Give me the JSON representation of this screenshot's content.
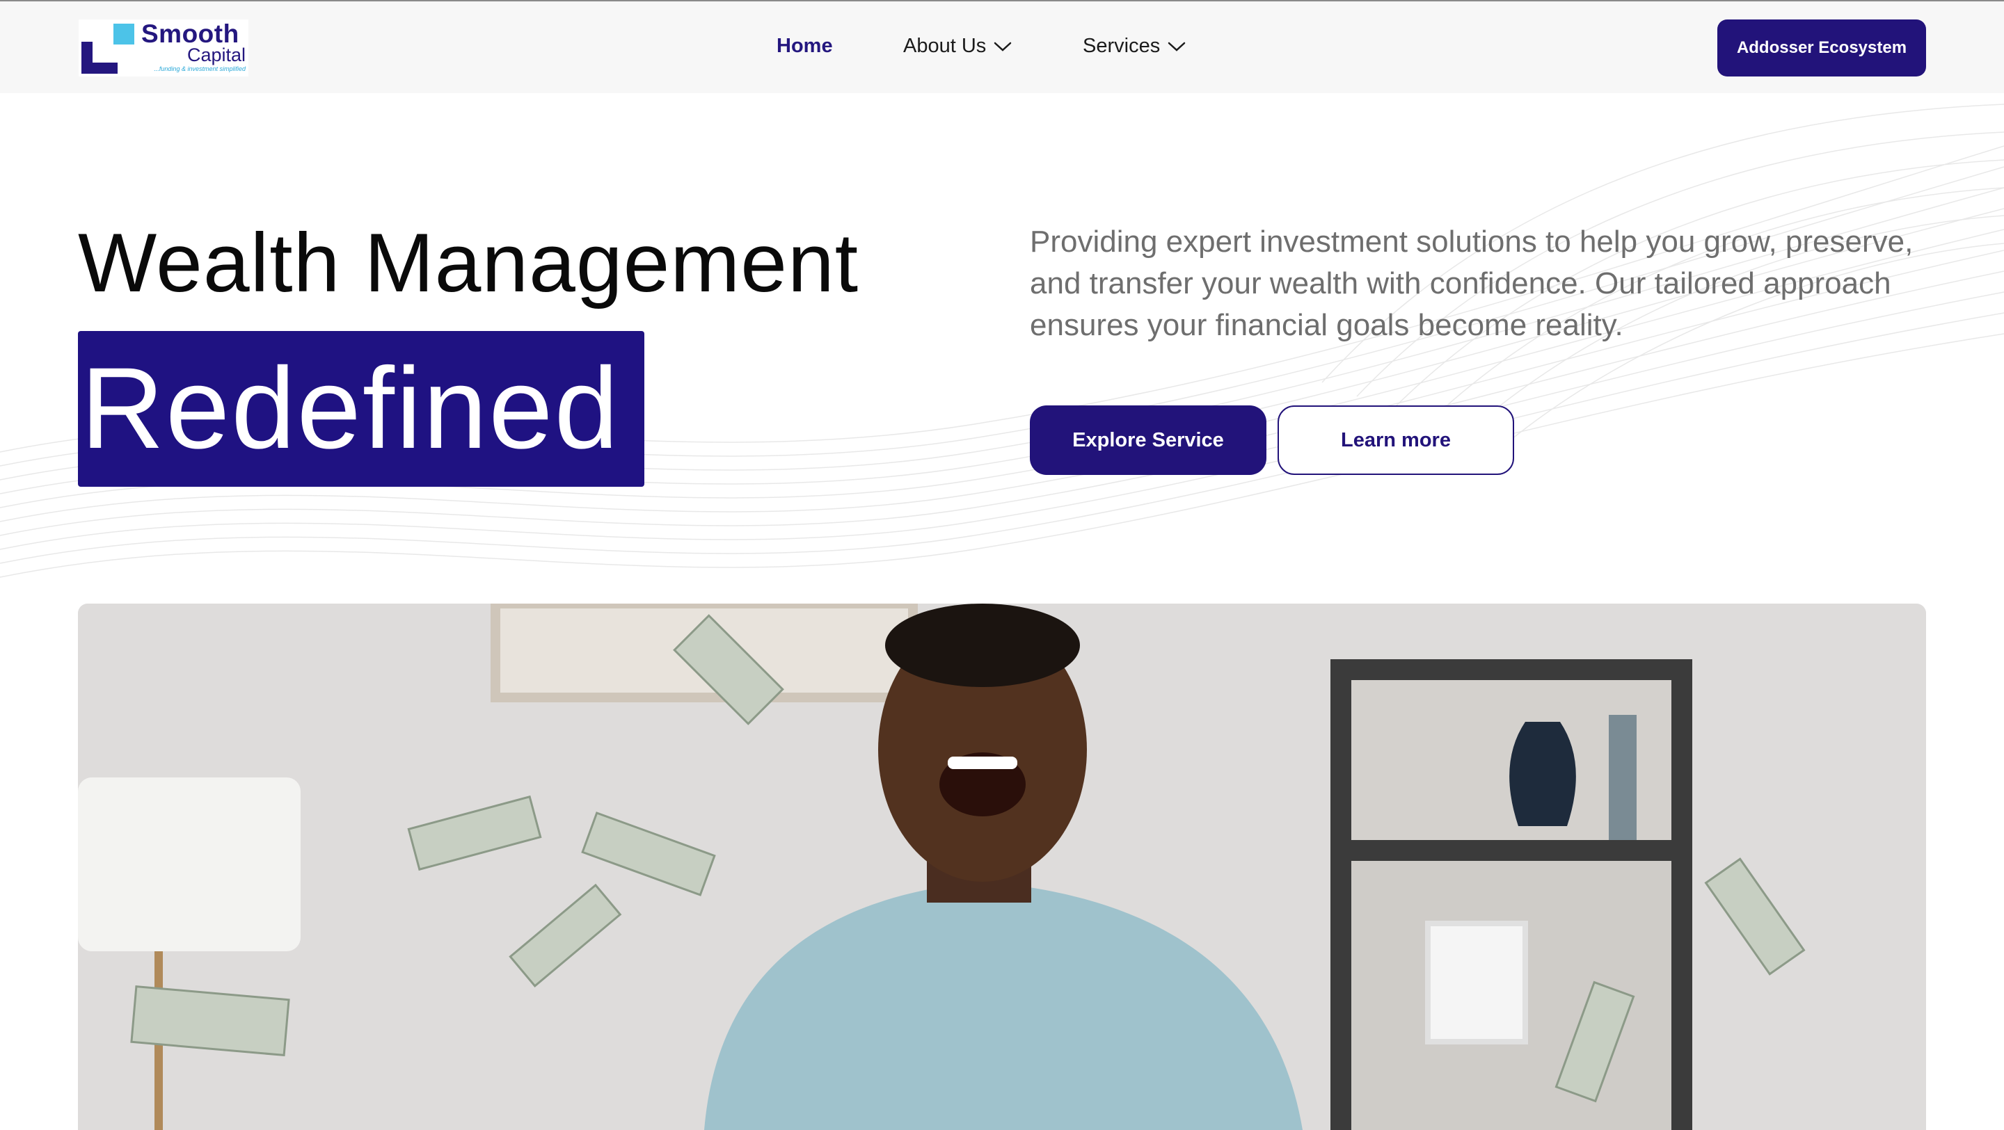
{
  "brand": {
    "name_line1": "Smooth",
    "name_line2": "Capital",
    "tagline": "...funding & investment simplified",
    "colors": {
      "primary": "#22137a",
      "accent": "#4cc3e8"
    }
  },
  "nav": {
    "items": [
      {
        "label": "Home",
        "active": true
      },
      {
        "label": "About Us",
        "has_dropdown": true
      },
      {
        "label": "Services",
        "has_dropdown": true
      }
    ],
    "cta_label": "Addosser Ecosystem"
  },
  "hero": {
    "title": "Wealth Management",
    "highlight": "Redefined",
    "description": "Providing expert investment solutions to help you grow, preserve, and transfer your wealth with confidence. Our tailored approach ensures your financial goals become reality.",
    "primary_button": "Explore Service",
    "secondary_button": "Learn more"
  },
  "icons": [
    "chevron-down-icon",
    "logo-mark-icon"
  ]
}
